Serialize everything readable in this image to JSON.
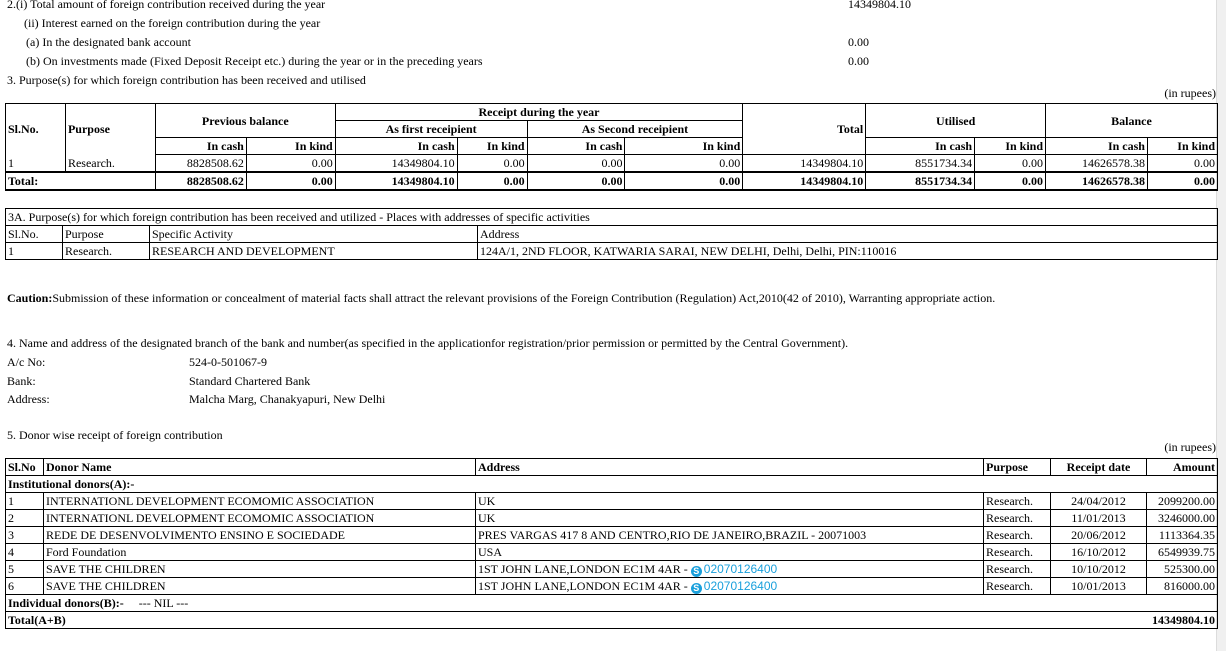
{
  "section2": {
    "line_i": "2.(i) Total amount of foreign contribution received during the year",
    "line_i_value": "14349804.10",
    "line_ii": "(ii) Interest earned on the foreign contribution during the year",
    "line_a": "(a)   In the designated bank account",
    "line_a_value": "0.00",
    "line_b": "(b)   On investments made (Fixed Deposit Receipt etc.) during the year or in the preceding years",
    "line_b_value": "0.00"
  },
  "section3": {
    "heading": "3.  Purpose(s) for which foreign contribution has been received and utilised",
    "unit": "(in rupees)",
    "headers": {
      "slno": "Sl.No.",
      "purpose": "Purpose",
      "previous_balance": "Previous balance",
      "receipt_year": "Receipt during the year",
      "first_recipient": "As first receipient",
      "second_recipient": "As Second receipient",
      "total": "Total",
      "utilised": "Utilised",
      "balance": "Balance",
      "in_cash": "In cash",
      "in_kind": "In kind"
    },
    "row": {
      "slno": "1",
      "purpose": "Research.",
      "prev_cash": "8828508.62",
      "prev_kind": "0.00",
      "first_cash": "14349804.10",
      "first_kind": "0.00",
      "second_cash": "0.00",
      "second_kind": "0.00",
      "total": "14349804.10",
      "util_cash": "8551734.34",
      "util_kind": "0.00",
      "bal_cash": "14626578.38",
      "bal_kind": "0.00"
    },
    "total_row": {
      "label": "Total:",
      "prev_cash": "8828508.62",
      "prev_kind": "0.00",
      "first_cash": "14349804.10",
      "first_kind": "0.00",
      "second_cash": "0.00",
      "second_kind": "0.00",
      "total": "14349804.10",
      "util_cash": "8551734.34",
      "util_kind": "0.00",
      "bal_cash": "14626578.38",
      "bal_kind": "0.00"
    }
  },
  "section3a": {
    "heading": "3A. Purpose(s) for which foreign contribution has been received and utilized - Places with addresses of specific activities",
    "headers": {
      "slno": "Sl.No.",
      "purpose": "Purpose",
      "activity": "Specific Activity",
      "address": "Address"
    },
    "row": {
      "slno": "1",
      "purpose": "Research.",
      "activity": "RESEARCH AND DEVELOPMENT",
      "address": "124A/1, 2ND FLOOR, KATWARIA SARAI, NEW DELHI, Delhi, Delhi, PIN:110016"
    }
  },
  "caution": {
    "label": "Caution:",
    "text": "Submission of these information or concealment of material facts shall attract the relevant provisions of the Foreign Contribution (Regulation) Act,2010(42 of 2010), Warranting appropriate action."
  },
  "section4": {
    "heading": "4.  Name and address of the designated branch of the bank and number(as specified in the applicationfor registration/prior permission or permitted by the Central Government).",
    "ac_label": "A/c No:",
    "ac_value": "524-0-501067-9",
    "bank_label": "Bank:",
    "bank_value": "Standard Chartered Bank",
    "address_label": "Address:",
    "address_value": "Malcha Marg, Chanakyapuri, New Delhi"
  },
  "section5": {
    "heading": "5. Donor wise receipt of foreign contribution",
    "unit": "(in rupees)",
    "headers": {
      "slno": "Sl.No",
      "donor": "Donor Name",
      "address": "Address",
      "purpose": "Purpose",
      "date": "Receipt date",
      "amount": "Amount"
    },
    "institutional_label": "Institutional donors(A):-",
    "rows": [
      {
        "slno": "1",
        "donor": "INTERNATIONL DEVELOPMENT ECOMOMIC ASSOCIATION",
        "address": "UK",
        "phone": "",
        "purpose": "Research.",
        "date": "24/04/2012",
        "amount": "2099200.00"
      },
      {
        "slno": "2",
        "donor": "INTERNATIONL DEVELOPMENT ECOMOMIC ASSOCIATION",
        "address": "UK",
        "phone": "",
        "purpose": "Research.",
        "date": "11/01/2013",
        "amount": "3246000.00"
      },
      {
        "slno": "3",
        "donor": "REDE DE DESENVOLVIMENTO ENSINO E SOCIEDADE",
        "address": "PRES VARGAS 417 8 AND CENTRO,RIO DE JANEIRO,BRAZIL - 20071003",
        "phone": "",
        "purpose": "Research.",
        "date": "20/06/2012",
        "amount": "1113364.35"
      },
      {
        "slno": "4",
        "donor": "Ford Foundation",
        "address": "USA",
        "phone": "",
        "purpose": "Research.",
        "date": "16/10/2012",
        "amount": "6549939.75"
      },
      {
        "slno": "5",
        "donor": "SAVE THE CHILDREN",
        "address": "1ST JOHN LANE,LONDON EC1M 4AR - ",
        "phone": "02070126400",
        "purpose": "Research.",
        "date": "10/10/2012",
        "amount": "525300.00"
      },
      {
        "slno": "6",
        "donor": "SAVE THE CHILDREN",
        "address": "1ST JOHN LANE,LONDON EC1M 4AR - ",
        "phone": "02070126400",
        "purpose": "Research.",
        "date": "10/01/2013",
        "amount": "816000.00"
      }
    ],
    "individual_label": "Individual donors(B):-",
    "individual_value": "--- NIL ---",
    "total_label": "Total(A+B)",
    "total_value": "14349804.10"
  }
}
